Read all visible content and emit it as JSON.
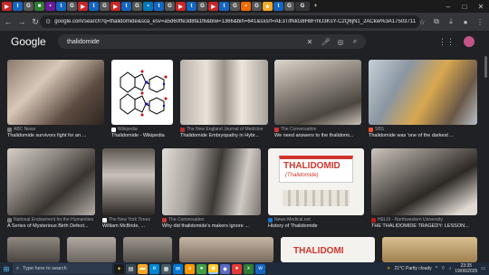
{
  "browser": {
    "url": "google.com/search?q=thalidomide&sca_esv=a5d60ffe3d8fa1f6&biw=1366&bih=641&sxsrf=AE3TifNkG8H8FmU3KsY-C2Q6jN1_2ACkw%3A1750371178599&tbm=isch&ved=2ahUKEwi..."
  },
  "search": {
    "logo": "Google",
    "query": "thalidomide"
  },
  "results": [
    {
      "source": "ABC News",
      "title": "Thalidomide survivors fight for an ..."
    },
    {
      "source": "Wikipedia",
      "title": "Thalidomide - Wikipedia"
    },
    {
      "source": "The New England Journal of Medicine",
      "title": "Thalidomide Embryopathy in Hybr..."
    },
    {
      "source": "The Conversation",
      "title": "We need answers to the thalidomi..."
    },
    {
      "source": "SBS",
      "title": "Thalidomide was 'one of the darkest ..."
    },
    {
      "source": "National Endowment for the Humanities",
      "title": "A Series of Mysterious Birth Defect..."
    },
    {
      "source": "The New York Times",
      "title": "William McBride, ..."
    },
    {
      "source": "The Conversation",
      "title": "Why did thalidomide's makers ignore ..."
    },
    {
      "source": "News-Medical.net",
      "title": "History of Thalidomide"
    },
    {
      "source": "HELIX - Northwestern University",
      "title": "THE THALIDOMIDE TRAGEDY: LESSON..."
    }
  ],
  "product": {
    "brand": "THALIDOMID",
    "sub": "(Thalidomide)",
    "brand2": "THALIDOMI"
  },
  "taskbar": {
    "search_placeholder": "Type here to search",
    "weather": "21°C  Partly cloudy",
    "time": "23:35",
    "date": "19/06/2025"
  },
  "colors": {
    "background": "#202124",
    "text": "#e8eaed",
    "secondary": "#9aa0a6",
    "avatar": "#c2548a"
  }
}
